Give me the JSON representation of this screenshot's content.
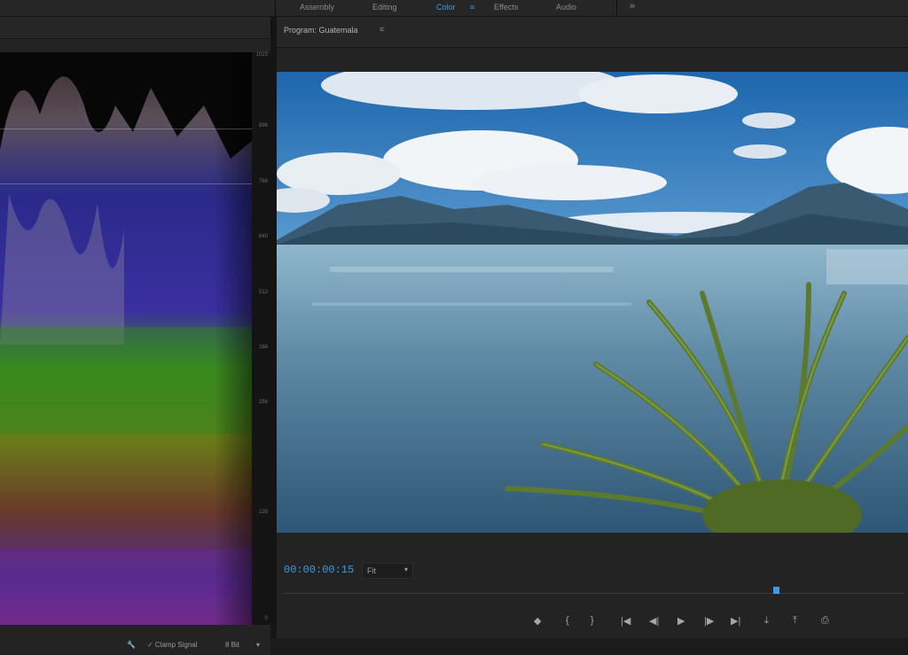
{
  "workspaces": [
    "Assembly",
    "Editing",
    "Color",
    "Effects",
    "Audio"
  ],
  "active_workspace": "Color",
  "active_marker": "≡",
  "plus_label": "»",
  "scope": {
    "ticks": [
      "1023",
      "896",
      "768",
      "640",
      "512",
      "384",
      "256",
      "128",
      "0"
    ],
    "footer": {
      "wrench_label": "🔧",
      "clamp_label": "✓ Clamp Signal",
      "bits_label": "8 Bit",
      "menu_label": "▾"
    }
  },
  "program": {
    "title": "Program: Guatemala",
    "menu_label": "≡",
    "timecode": "00:00:00:15",
    "fit_value": "Fit",
    "fit_arrow": "▾",
    "transport": [
      "◆",
      "{",
      "}",
      "|◀",
      "◀|",
      "▶",
      "|▶",
      "▶|",
      "⤓",
      "⤒",
      "⎙"
    ]
  },
  "colors": {
    "accent": "#3c9be2",
    "sky": "#1f6fae",
    "lake": "#5f8aa3",
    "mountain": "#2f4d63",
    "palm": "#5c7a2d"
  }
}
